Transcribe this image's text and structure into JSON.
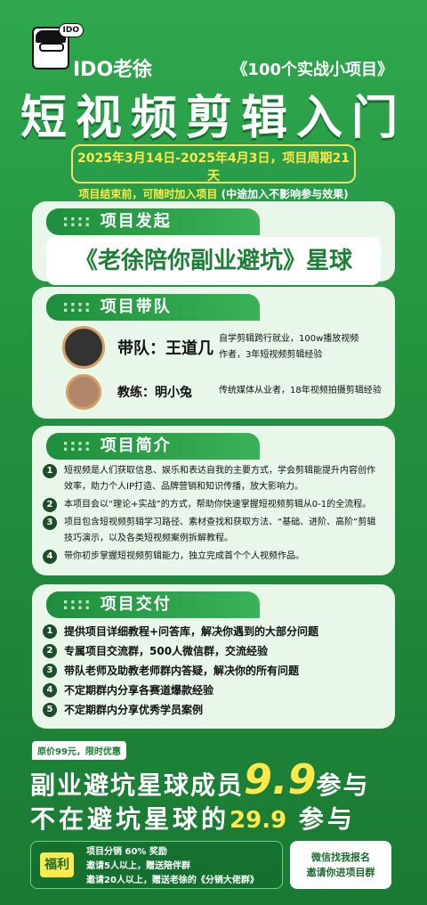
{
  "header": {
    "logo_tag": "IDO",
    "brand": "IDO老徐",
    "series": "《100个实战小项目》",
    "title": "短视频剪辑入门",
    "date_line": "2025年3月14日-2025年4月3日，项目周期21天",
    "join_note": "项目结束前，可随时加入项目",
    "join_sub": "(中途加入不影响参与效果)"
  },
  "sections": {
    "launch": {
      "title": "项目发起",
      "planet": "《老徐陪你副业避坑》星球"
    },
    "team": {
      "title": "项目带队",
      "members": [
        {
          "role": "带队：王道几",
          "desc1": "自学剪辑跨行就业，100w播放视频",
          "desc2": "作者，3年短视频剪辑经验"
        },
        {
          "role": "教练：明小兔",
          "desc1": "传统媒体从业者，18年视频拍摄剪辑经验"
        }
      ]
    },
    "intro": {
      "title": "项目简介",
      "items": [
        {
          "n": "1",
          "text": "短视频是人们获取信息、娱乐和表达自我的主要方式，学会剪辑能提升内容创作效率，助力个人IP打造、品牌营销和知识传播，放大影响力。"
        },
        {
          "n": "2",
          "text": "本项目会以“理论+实战”的方式，帮助你快速掌握短视频剪辑从0-1的全流程。"
        },
        {
          "n": "3",
          "text": "项目包含短视频剪辑学习路径、素材查找和获取方法、“基础、进阶、高阶”剪辑技巧演示，以及各类短视频案例拆解教程。"
        },
        {
          "n": "4",
          "text": "带你初步掌握短视频剪辑能力，独立完成首个个人视频作品。"
        }
      ]
    },
    "delivery": {
      "title": "项目交付",
      "items": [
        {
          "n": "1",
          "text": "提供项目详细教程+问答库，解决你遇到的大部分问题"
        },
        {
          "n": "2",
          "text": "专属项目交流群，500人微信群，交流经验"
        },
        {
          "n": "3",
          "text": "带队老师及助教老师群内答疑，解决你的所有问题"
        },
        {
          "n": "4",
          "text": "不定期群内分享各赛道爆款经验"
        },
        {
          "n": "5",
          "text": "不定期群内分享优秀学员案例"
        }
      ]
    }
  },
  "pricing": {
    "tag": "原价99元，限时优惠",
    "line1_prefix": "副业避坑星球成员",
    "line1_price": "9.9",
    "line1_suffix": "参与",
    "line2_prefix": "不在避坑星球的",
    "line2_price": "29.9",
    "line2_suffix": "参与"
  },
  "benefit": {
    "label": "福利",
    "lines": [
      "项目分销 60% 奖励",
      "邀请5人以上，赠送陪伴群",
      "邀请20人以上，赠送老徐的《分销大佬群》"
    ]
  },
  "wechat": {
    "line1": "微信找我报名",
    "line2": "邀请你进项目群"
  },
  "colors": {
    "bg": "#23923f",
    "accent": "#ffe94a",
    "card": "#e9f6ea"
  }
}
